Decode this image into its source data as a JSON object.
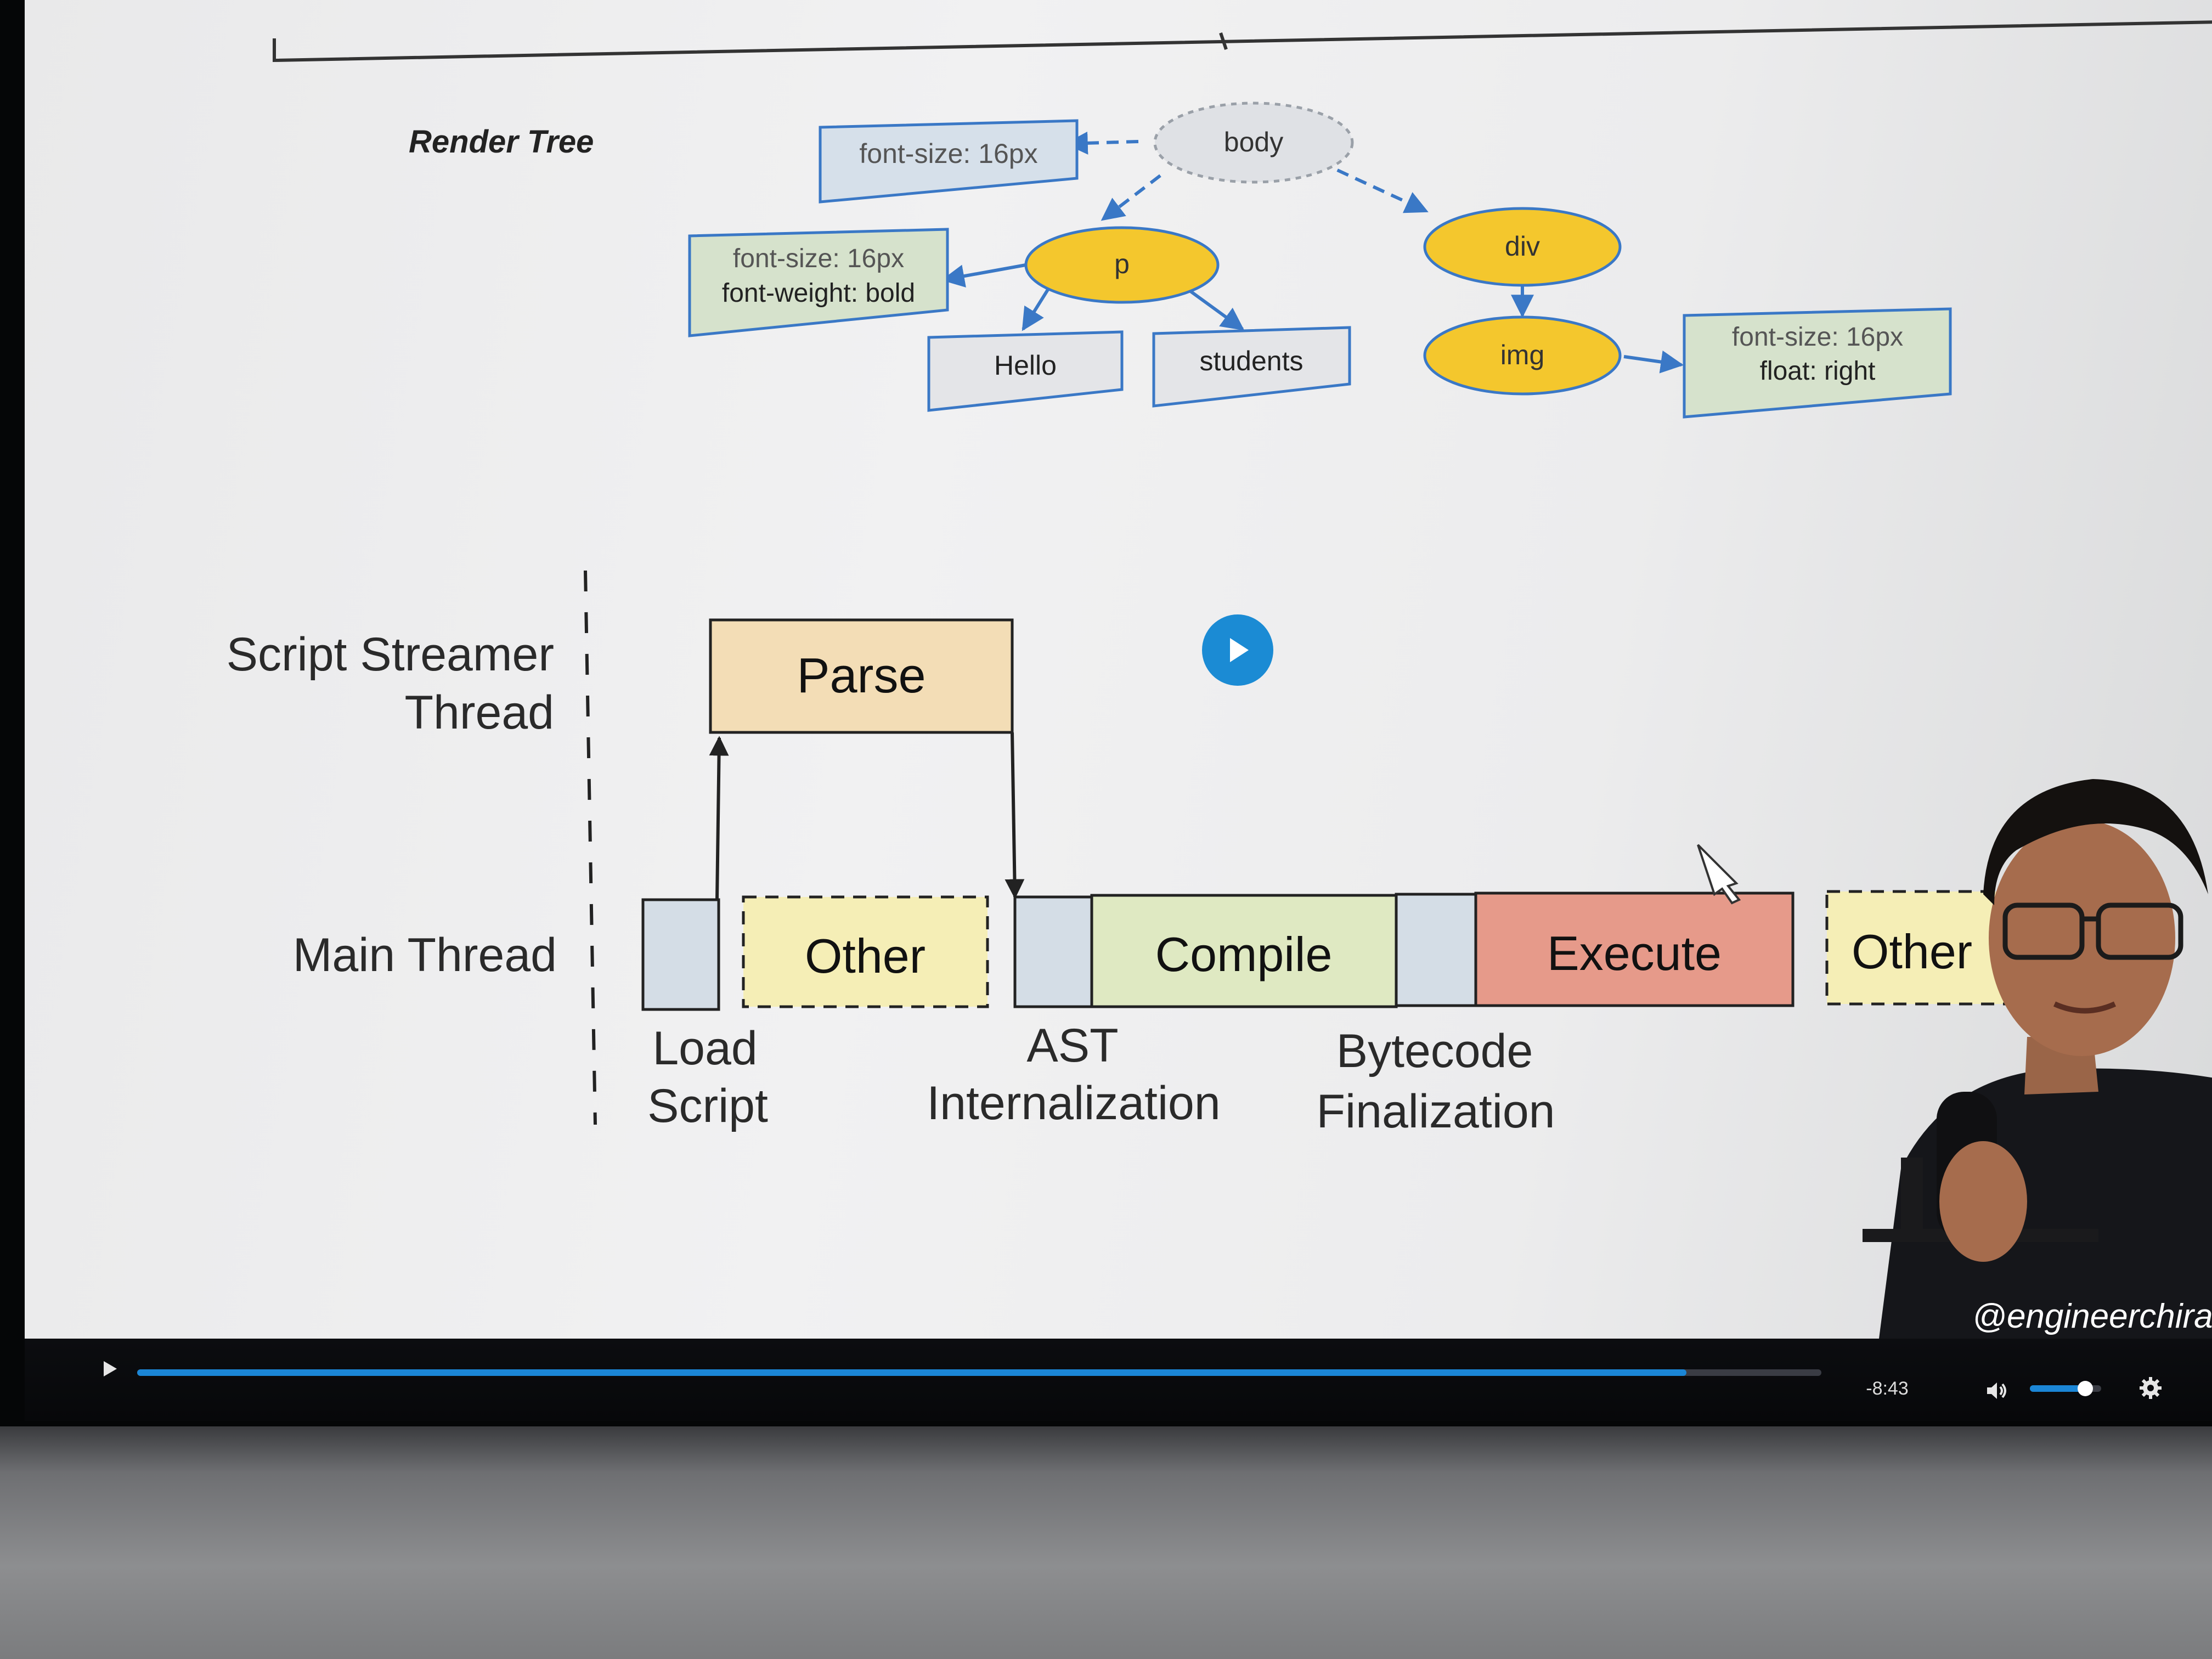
{
  "render_tree": {
    "heading": "Render Tree",
    "nodes": {
      "body": "body",
      "p": "p",
      "div": "div",
      "img": "img",
      "hello": "Hello",
      "students": "students"
    },
    "styles": {
      "body_style": "font-size: 16px",
      "p_style_line1": "font-size: 16px",
      "p_style_line2": "font-weight: bold",
      "img_style_line1": "font-size: 16px",
      "img_style_line2": "float: right"
    }
  },
  "timeline": {
    "labels": {
      "streamer_line1": "Script Streamer",
      "streamer_line2": "Thread",
      "main": "Main Thread"
    },
    "blocks": {
      "parse": "Parse",
      "other1": "Other",
      "compile": "Compile",
      "execute": "Execute",
      "other2": "Other"
    },
    "captions": {
      "load1": "Load",
      "load2": "Script",
      "ast1": "AST",
      "ast2": "Internalization",
      "bytecode1": "Bytecode",
      "bytecode2": "Finalization"
    },
    "colors": {
      "parse": "#f3ddb6",
      "other": "#f5eeb6",
      "compile": "#dfe9c2",
      "execute": "#e69a8a",
      "grey_block": "#d4dde6",
      "node_yellow": "#f4c72d",
      "style_box": "#d6e2cc",
      "arrow": "#3a78c6"
    }
  },
  "presenter": {
    "shirt_text": "@engineerchirag"
  },
  "player": {
    "time_remaining": "-8:43",
    "progress_fraction": 0.92,
    "volume_fraction": 0.78
  }
}
